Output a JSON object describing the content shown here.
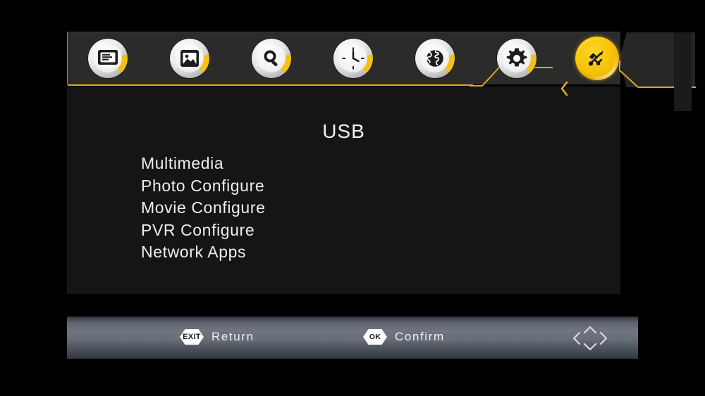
{
  "app": {
    "title": "USB",
    "accent_color": "#f2c018",
    "panel_bg": "#151515",
    "header_bg": "#2b2b2b"
  },
  "header": {
    "tabs": [
      {
        "id": "channel",
        "icon": "channel-list-icon",
        "label": "Channel",
        "active": false
      },
      {
        "id": "picture",
        "icon": "picture-icon",
        "label": "Picture",
        "active": false
      },
      {
        "id": "search",
        "icon": "search-icon",
        "label": "Search",
        "active": false
      },
      {
        "id": "time",
        "icon": "clock-icon",
        "label": "Time",
        "active": false
      },
      {
        "id": "network",
        "icon": "globe-icon",
        "label": "Network",
        "active": false
      },
      {
        "id": "system",
        "icon": "gear-icon",
        "label": "System",
        "active": false
      },
      {
        "id": "usb",
        "icon": "usb-icon",
        "label": "USB",
        "active": true
      }
    ],
    "prev_arrow_icon": "chevron-left-icon"
  },
  "main": {
    "title": "USB",
    "menu_items": [
      {
        "label": "Multimedia"
      },
      {
        "label": "Photo Configure"
      },
      {
        "label": "Movie Configure"
      },
      {
        "label": "PVR Configure"
      },
      {
        "label": "Network Apps"
      }
    ]
  },
  "footer": {
    "hints": [
      {
        "key": "EXIT",
        "label": "Return"
      },
      {
        "key": "OK",
        "label": "Confirm"
      }
    ],
    "navigation_icon": "dpad-arrows-icon"
  }
}
